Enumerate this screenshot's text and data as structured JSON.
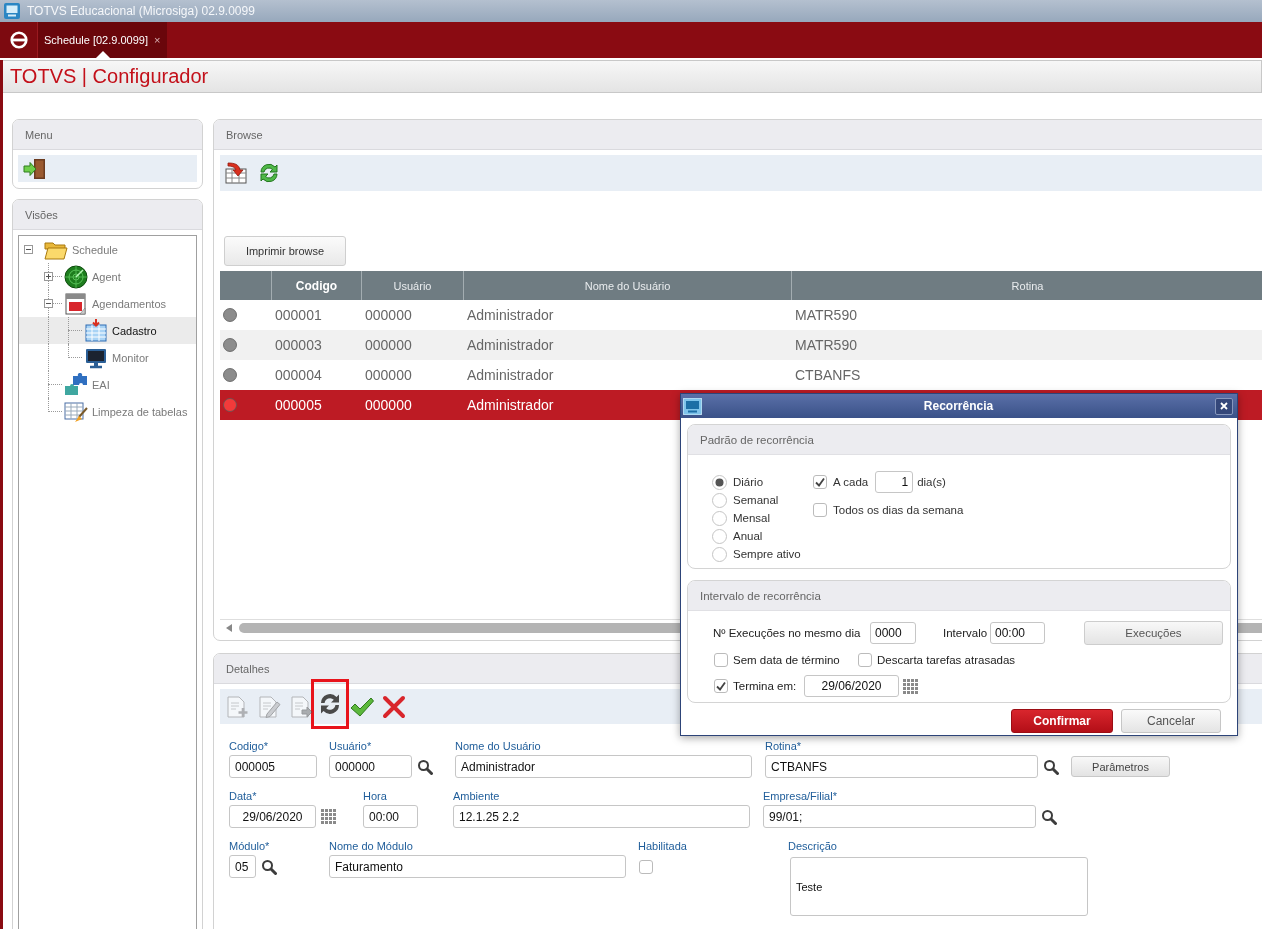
{
  "window": {
    "title": "TOTVS Educacional (Microsiga) 02.9.0099"
  },
  "tabs": [
    {
      "label": "Schedule [02.9.0099]",
      "close": "×",
      "selected": true
    }
  ],
  "header": {
    "title": "TOTVS | Configurador"
  },
  "menu_panel": {
    "title": "Menu"
  },
  "views_panel": {
    "title": "Visões",
    "tree": [
      {
        "label": "Schedule",
        "kind": "folder",
        "expanded": true,
        "selected": false,
        "children": [
          {
            "label": "Agent",
            "kind": "radar",
            "expanded": false,
            "selected": false
          },
          {
            "label": "Agendamentos",
            "kind": "calendar",
            "expanded": true,
            "selected": false,
            "children": [
              {
                "label": "Cadastro",
                "kind": "grid",
                "selected": true
              },
              {
                "label": "Monitor",
                "kind": "monitor",
                "selected": false
              }
            ]
          },
          {
            "label": "EAI",
            "kind": "puzzle",
            "selected": false
          },
          {
            "label": "Limpeza de tabelas",
            "kind": "cleanup",
            "selected": false
          }
        ]
      }
    ]
  },
  "browse": {
    "title": "Browse",
    "print_button": "Imprimir browse",
    "table": {
      "columns": [
        {
          "label": "Codigo",
          "sorted": true
        },
        {
          "label": "Usuário",
          "sorted": false
        },
        {
          "label": "Nome do Usuário",
          "sorted": false
        },
        {
          "label": "Rotina",
          "sorted": false
        }
      ],
      "rows": [
        {
          "color": "#8c8c8c",
          "selected": false,
          "cells": [
            "000001",
            "000000",
            "Administrador",
            "MATR590"
          ]
        },
        {
          "color": "#8c8c8c",
          "selected": false,
          "cells": [
            "000003",
            "000000",
            "Administrador",
            "MATR590"
          ]
        },
        {
          "color": "#8c8c8c",
          "selected": false,
          "cells": [
            "000004",
            "000000",
            "Administrador",
            "CTBANFS"
          ]
        },
        {
          "color": "#f23a3a",
          "selected": true,
          "cells": [
            "000005",
            "000000",
            "Administrador"
          ]
        }
      ]
    }
  },
  "details": {
    "title": "Detalhes",
    "toolbar": [
      {
        "kind": "new",
        "disabled": true,
        "highlighted": false
      },
      {
        "kind": "edit",
        "disabled": true,
        "highlighted": false
      },
      {
        "kind": "export",
        "disabled": true,
        "highlighted": false
      },
      {
        "kind": "refresh",
        "disabled": false,
        "highlighted": true
      },
      {
        "kind": "confirm",
        "disabled": false,
        "highlighted": false
      },
      {
        "kind": "cancel",
        "disabled": false,
        "highlighted": false
      }
    ],
    "form": {
      "rows": [
        [
          {
            "kind": "text",
            "label": "Codigo*",
            "value": "000005"
          },
          {
            "kind": "lookup",
            "label": "Usuário*",
            "value": "000000"
          },
          {
            "kind": "text",
            "label": "Nome do Usuário",
            "value": "Administrador"
          },
          {
            "kind": "lookup",
            "label": "Rotina*",
            "value": "CTBANFS",
            "button": "Parâmetros"
          }
        ],
        [
          {
            "kind": "date",
            "label": "Data*",
            "value": "29/06/2020"
          },
          {
            "kind": "text",
            "label": "Hora",
            "value": "00:00"
          },
          {
            "kind": "text",
            "label": "Ambiente",
            "value": "12.1.25 2.2"
          },
          {
            "kind": "lookup",
            "label": "Empresa/Filial*",
            "value": "99/01;"
          }
        ],
        [
          {
            "kind": "lookup",
            "label": "Módulo*",
            "value": "05"
          },
          {
            "kind": "text",
            "label": "Nome do Módulo",
            "value": "Faturamento"
          },
          {
            "kind": "checkbox",
            "label": "Habilitada",
            "checked": false
          },
          {
            "kind": "memo",
            "label": "Descrição",
            "value": "Teste"
          }
        ]
      ]
    }
  },
  "dialog": {
    "title": "Recorrência",
    "pattern": {
      "title": "Padrão de recorrência",
      "options": [
        {
          "label": "Diário",
          "selected": true
        },
        {
          "label": "Semanal",
          "selected": false
        },
        {
          "label": "Mensal",
          "selected": false
        },
        {
          "label": "Anual",
          "selected": false
        },
        {
          "label": "Sempre ativo",
          "selected": false
        }
      ],
      "every": {
        "label": "A cada",
        "checked": true,
        "value": "1",
        "unit": "dia(s)"
      },
      "all_days": {
        "label": "Todos os dias da semana",
        "checked": false
      }
    },
    "interval": {
      "title": "Intervalo de recorrência",
      "runs_label": "Nº Execuções no mesmo dia",
      "runs_value": "0000",
      "interval_label": "Intervalo",
      "interval_value": "00:00",
      "runs_button": "Execuções",
      "no_end": {
        "label": "Sem data de término",
        "checked": false
      },
      "discard_late": {
        "label": "Descarta tarefas atrasadas",
        "checked": false
      },
      "ends_on": {
        "label": "Termina em:",
        "checked": true,
        "value": "29/06/2020"
      }
    },
    "buttons": [
      {
        "label": "Confirmar",
        "kind": "primary"
      },
      {
        "label": "Cancelar",
        "kind": "secondary"
      }
    ]
  }
}
